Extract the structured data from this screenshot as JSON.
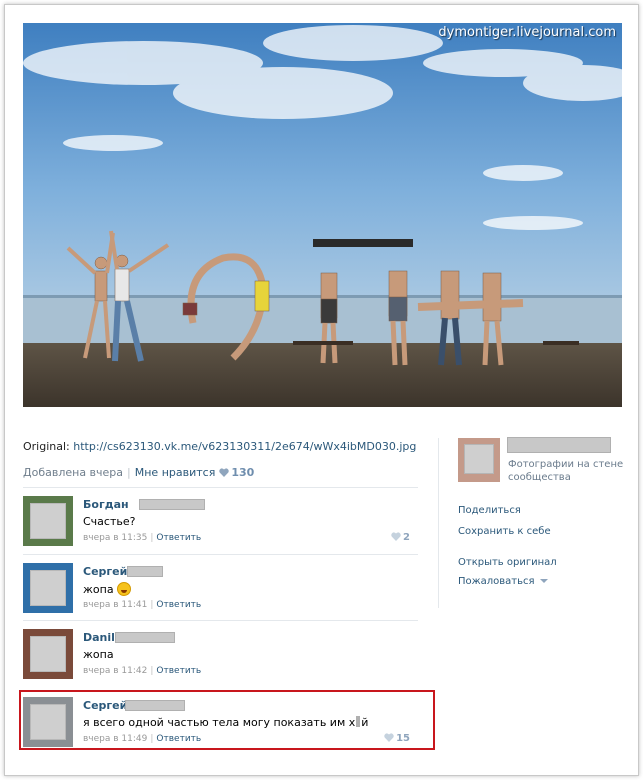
{
  "watermark": "dymontiger.livejournal.com",
  "post": {
    "original_label": "Original:",
    "original_url": "http://cs623130.vk.me/v623130311/2e674/wWx4ibMD030.jpg",
    "added": "Добавлена вчера",
    "like_label": "Мне нравится",
    "like_count": "130"
  },
  "comments": [
    {
      "name": "Богдан",
      "text": "Счастье?",
      "time": "вчера в 11:35",
      "reply": "Ответить",
      "likes": "2"
    },
    {
      "name": "Сергей",
      "text": "жопа",
      "time": "вчера в 11:41",
      "reply": "Ответить",
      "likes": ""
    },
    {
      "name": "Danil",
      "text": "жопа",
      "time": "вчера в 11:42",
      "reply": "Ответить",
      "likes": ""
    },
    {
      "name": "Сергей",
      "text_before": "я всего одной частью тела могу показать им х",
      "text_after": "й",
      "time": "вчера в 11:49",
      "reply": "Ответить",
      "likes": "15"
    }
  ],
  "sidebar": {
    "album_desc": "Фотографии на стене сообщества",
    "share": "Поделиться",
    "save": "Сохранить к себе",
    "open_original": "Открыть оригинал",
    "report": "Пожаловаться"
  },
  "colors": {
    "link": "#2b587a",
    "highlight": "#c8161d",
    "sky": "#5f9bd0",
    "sand": "#4a4034"
  },
  "icons": [
    "heart-icon",
    "smiley-icon",
    "chevron-down-icon"
  ]
}
